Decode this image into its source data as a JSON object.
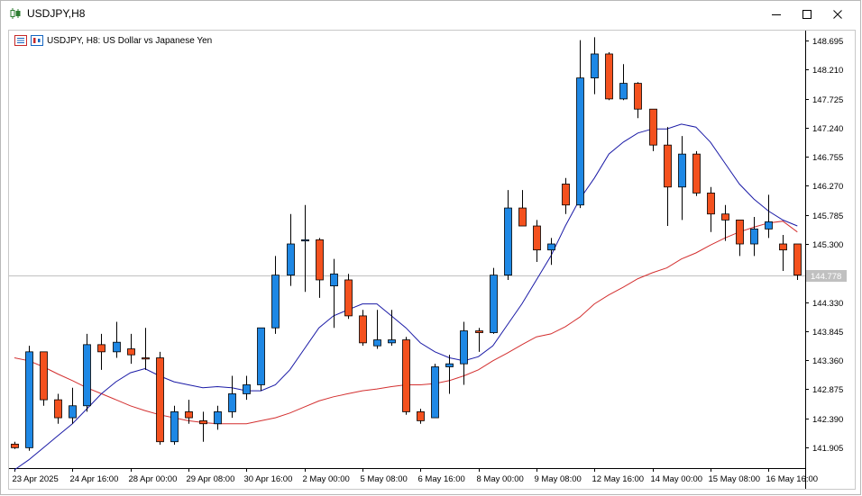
{
  "window": {
    "title": "USDJPY,H8",
    "title_icon": "candlestick-chart-icon",
    "controls": [
      "minimize-icon",
      "maximize-icon",
      "close-icon"
    ]
  },
  "chart": {
    "header_text": "USDJPY, H8:  US Dollar vs Japanese Yen",
    "current_price_label": "144.778",
    "current_price": 144.778
  },
  "chart_data": {
    "type": "candlestick",
    "symbol": "USDJPY",
    "timeframe": "H8",
    "ylim": [
      141.56,
      148.86
    ],
    "y_ticks": [
      "148.695",
      "148.210",
      "147.725",
      "147.240",
      "146.755",
      "146.270",
      "145.785",
      "145.300",
      "144.330",
      "143.845",
      "143.360",
      "142.875",
      "142.390",
      "141.905"
    ],
    "y_tick_values": [
      148.695,
      148.21,
      147.725,
      147.24,
      146.755,
      146.27,
      145.785,
      145.3,
      144.33,
      143.845,
      143.36,
      142.875,
      142.39,
      141.905
    ],
    "x_labels": [
      "23 Apr 2025",
      "24 Apr 16:00",
      "28 Apr 00:00",
      "29 Apr 08:00",
      "30 Apr 16:00",
      "2 May 00:00",
      "5 May 08:00",
      "6 May 16:00",
      "8 May 00:00",
      "9 May 08:00",
      "12 May 16:00",
      "14 May 00:00",
      "15 May 08:00",
      "16 May 16:00"
    ],
    "x_label_candle_index": [
      0,
      4,
      8,
      12,
      16,
      20,
      24,
      28,
      32,
      36,
      40,
      44,
      48,
      52
    ],
    "colors": {
      "bull": "#1e88e5",
      "bear": "#f4511e",
      "wick": "#000000",
      "ma_fast": "#1a1aa6",
      "ma_slow": "#d32f2f",
      "price_line": "#c0c0c0"
    },
    "candles": [
      {
        "o": 141.96,
        "h": 142.0,
        "l": 141.88,
        "c": 141.9
      },
      {
        "o": 141.9,
        "h": 143.6,
        "l": 141.85,
        "c": 143.5
      },
      {
        "o": 143.5,
        "h": 143.5,
        "l": 142.6,
        "c": 142.7
      },
      {
        "o": 142.7,
        "h": 142.8,
        "l": 142.3,
        "c": 142.4
      },
      {
        "o": 142.4,
        "h": 142.9,
        "l": 142.3,
        "c": 142.6
      },
      {
        "o": 142.6,
        "h": 143.8,
        "l": 142.5,
        "c": 143.62
      },
      {
        "o": 143.62,
        "h": 143.8,
        "l": 143.2,
        "c": 143.5
      },
      {
        "o": 143.5,
        "h": 144.0,
        "l": 143.4,
        "c": 143.66
      },
      {
        "o": 143.55,
        "h": 143.8,
        "l": 143.3,
        "c": 143.45
      },
      {
        "o": 143.4,
        "h": 143.9,
        "l": 143.2,
        "c": 143.38
      },
      {
        "o": 143.4,
        "h": 143.5,
        "l": 141.95,
        "c": 142.0
      },
      {
        "o": 142.0,
        "h": 142.6,
        "l": 141.95,
        "c": 142.5
      },
      {
        "o": 142.5,
        "h": 142.7,
        "l": 142.3,
        "c": 142.4
      },
      {
        "o": 142.35,
        "h": 142.5,
        "l": 142.0,
        "c": 142.3
      },
      {
        "o": 142.3,
        "h": 142.6,
        "l": 142.2,
        "c": 142.5
      },
      {
        "o": 142.5,
        "h": 143.1,
        "l": 142.4,
        "c": 142.8
      },
      {
        "o": 142.8,
        "h": 143.1,
        "l": 142.7,
        "c": 142.95
      },
      {
        "o": 142.95,
        "h": 143.9,
        "l": 142.85,
        "c": 143.9
      },
      {
        "o": 143.9,
        "h": 145.1,
        "l": 143.8,
        "c": 144.78
      },
      {
        "o": 144.78,
        "h": 145.8,
        "l": 144.6,
        "c": 145.3
      },
      {
        "o": 145.35,
        "h": 145.95,
        "l": 144.5,
        "c": 145.37
      },
      {
        "o": 145.37,
        "h": 145.4,
        "l": 144.4,
        "c": 144.7
      },
      {
        "o": 144.6,
        "h": 145.05,
        "l": 143.9,
        "c": 144.8
      },
      {
        "o": 144.7,
        "h": 144.8,
        "l": 144.05,
        "c": 144.1
      },
      {
        "o": 144.1,
        "h": 144.2,
        "l": 143.6,
        "c": 143.65
      },
      {
        "o": 143.6,
        "h": 144.2,
        "l": 143.55,
        "c": 143.7
      },
      {
        "o": 143.65,
        "h": 144.2,
        "l": 143.6,
        "c": 143.7
      },
      {
        "o": 143.7,
        "h": 143.75,
        "l": 142.45,
        "c": 142.5
      },
      {
        "o": 142.5,
        "h": 142.55,
        "l": 142.3,
        "c": 142.35
      },
      {
        "o": 142.4,
        "h": 143.3,
        "l": 142.4,
        "c": 143.25
      },
      {
        "o": 143.25,
        "h": 143.45,
        "l": 142.8,
        "c": 143.3
      },
      {
        "o": 143.3,
        "h": 144.0,
        "l": 142.95,
        "c": 143.85
      },
      {
        "o": 143.85,
        "h": 143.9,
        "l": 143.5,
        "c": 143.82
      },
      {
        "o": 143.82,
        "h": 144.9,
        "l": 143.8,
        "c": 144.78
      },
      {
        "o": 144.78,
        "h": 146.2,
        "l": 144.7,
        "c": 145.9
      },
      {
        "o": 145.9,
        "h": 146.2,
        "l": 145.6,
        "c": 145.6
      },
      {
        "o": 145.6,
        "h": 145.7,
        "l": 145.0,
        "c": 145.2
      },
      {
        "o": 145.2,
        "h": 145.4,
        "l": 144.95,
        "c": 145.3
      },
      {
        "o": 146.3,
        "h": 146.4,
        "l": 145.8,
        "c": 145.95
      },
      {
        "o": 145.95,
        "h": 148.7,
        "l": 145.9,
        "c": 148.07
      },
      {
        "o": 148.07,
        "h": 148.75,
        "l": 147.8,
        "c": 148.47
      },
      {
        "o": 148.47,
        "h": 148.5,
        "l": 147.7,
        "c": 147.72
      },
      {
        "o": 147.72,
        "h": 148.3,
        "l": 147.7,
        "c": 147.98
      },
      {
        "o": 147.98,
        "h": 148.0,
        "l": 147.4,
        "c": 147.55
      },
      {
        "o": 147.55,
        "h": 147.55,
        "l": 146.85,
        "c": 146.95
      },
      {
        "o": 146.95,
        "h": 147.25,
        "l": 145.6,
        "c": 146.25
      },
      {
        "o": 146.25,
        "h": 147.1,
        "l": 145.7,
        "c": 146.8
      },
      {
        "o": 146.8,
        "h": 146.85,
        "l": 146.1,
        "c": 146.15
      },
      {
        "o": 146.15,
        "h": 146.25,
        "l": 145.5,
        "c": 145.8
      },
      {
        "o": 145.8,
        "h": 145.95,
        "l": 145.35,
        "c": 145.7
      },
      {
        "o": 145.7,
        "h": 145.7,
        "l": 145.1,
        "c": 145.3
      },
      {
        "o": 145.3,
        "h": 145.75,
        "l": 145.1,
        "c": 145.55
      },
      {
        "o": 145.55,
        "h": 146.12,
        "l": 145.4,
        "c": 145.67
      },
      {
        "o": 145.3,
        "h": 145.45,
        "l": 144.85,
        "c": 145.2
      },
      {
        "o": 145.3,
        "h": 145.3,
        "l": 144.7,
        "c": 144.78
      }
    ],
    "ma_fast": [
      141.53,
      141.7,
      141.9,
      142.1,
      142.3,
      142.55,
      142.8,
      143.0,
      143.15,
      143.22,
      143.1,
      143.0,
      142.95,
      142.9,
      142.92,
      142.9,
      142.85,
      142.85,
      142.95,
      143.2,
      143.55,
      143.9,
      144.1,
      144.2,
      144.3,
      144.3,
      144.1,
      143.9,
      143.65,
      143.5,
      143.4,
      143.35,
      143.42,
      143.6,
      143.95,
      144.3,
      144.7,
      145.1,
      145.6,
      146.05,
      146.4,
      146.8,
      147.0,
      147.15,
      147.22,
      147.22,
      147.3,
      147.25,
      147.0,
      146.65,
      146.3,
      146.05,
      145.85,
      145.7,
      145.6
    ],
    "ma_slow": [
      143.4,
      143.35,
      143.25,
      143.13,
      143.02,
      142.9,
      142.8,
      142.7,
      142.6,
      142.52,
      142.45,
      142.4,
      142.35,
      142.32,
      142.3,
      142.3,
      142.3,
      142.35,
      142.4,
      142.48,
      142.58,
      142.68,
      142.75,
      142.8,
      142.85,
      142.88,
      142.92,
      142.95,
      142.95,
      142.97,
      143.02,
      143.1,
      143.2,
      143.35,
      143.48,
      143.62,
      143.75,
      143.8,
      143.92,
      144.08,
      144.3,
      144.45,
      144.58,
      144.72,
      144.82,
      144.9,
      145.05,
      145.15,
      145.28,
      145.4,
      145.5,
      145.58,
      145.65,
      145.68,
      145.5
    ]
  }
}
